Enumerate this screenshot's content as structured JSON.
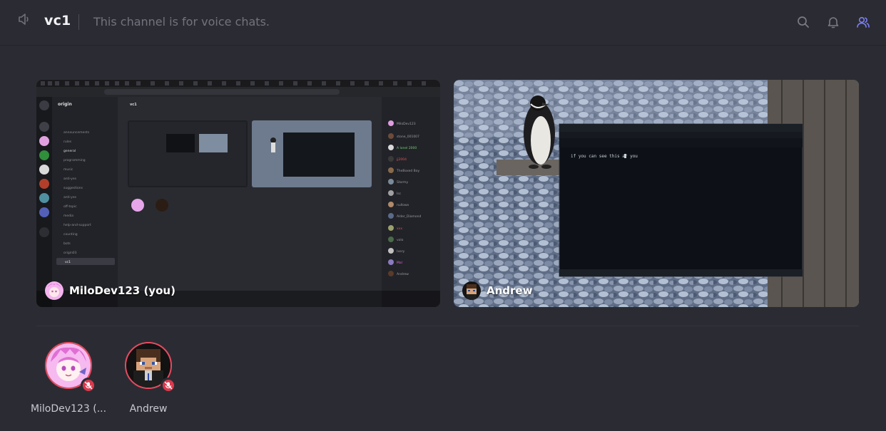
{
  "header": {
    "channel_name": "vc1",
    "topic": "This channel is for voice chats."
  },
  "streams": [
    {
      "name": "MiloDev123 (you)",
      "content": "screen-share"
    },
    {
      "name": "Andrew",
      "content": "camera"
    }
  ],
  "preview": {
    "server_name": "origin",
    "channel_name": "vc1",
    "terminal_text": "if you can see this ar you",
    "channels": [
      "announcements",
      "rules",
      "general",
      "programming",
      "music",
      "anti-yes",
      "suggestions",
      "anti-yes",
      "off-topic",
      "media",
      "help-and-support",
      "counting",
      "bots",
      "origin03"
    ],
    "members": [
      "MiloDev123",
      "stone_001007",
      "A lonel 2000",
      "jj2004",
      "TheBoxed Boy",
      "Stormy",
      "Isc",
      "nullowx",
      "Alder_Diamond",
      "xxx",
      "volo",
      "Ixory",
      "Mal",
      "Andrew"
    ]
  },
  "participants": [
    {
      "name": "MiloDev123 (...",
      "muted": true
    },
    {
      "name": "Andrew",
      "muted": true
    }
  ],
  "colors": {
    "background": "#2b2c33",
    "muted_badge": "#d83a4e",
    "accent_members": "#7b7ff2"
  }
}
